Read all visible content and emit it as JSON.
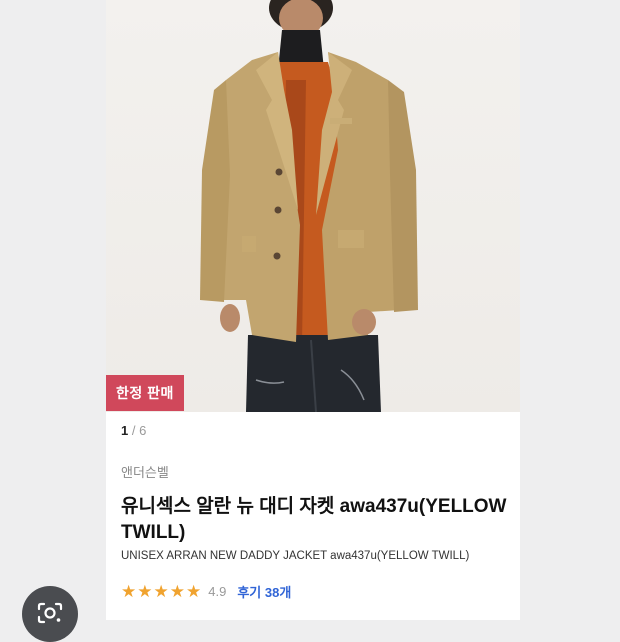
{
  "product": {
    "limited_badge": "한정 판매",
    "image_counter": {
      "current": "1",
      "separator": " / ",
      "total": "6"
    },
    "brand": "앤더슨벨",
    "title_ko": "유니섹스 알란 뉴 대디 자켓 awa437u(YELLOW TWILL)",
    "title_en": "UNISEX ARRAN NEW DADDY JACKET awa437u(YELLOW TWILL)",
    "rating": {
      "stars": 5,
      "score": "4.9",
      "reviews_label": "후기 38개"
    }
  },
  "colors": {
    "badge": "#d0485b",
    "star": "#f0a32f",
    "review_link": "#3064d6"
  },
  "icons": {
    "lens": "google-lens-icon",
    "star": "star-icon"
  }
}
